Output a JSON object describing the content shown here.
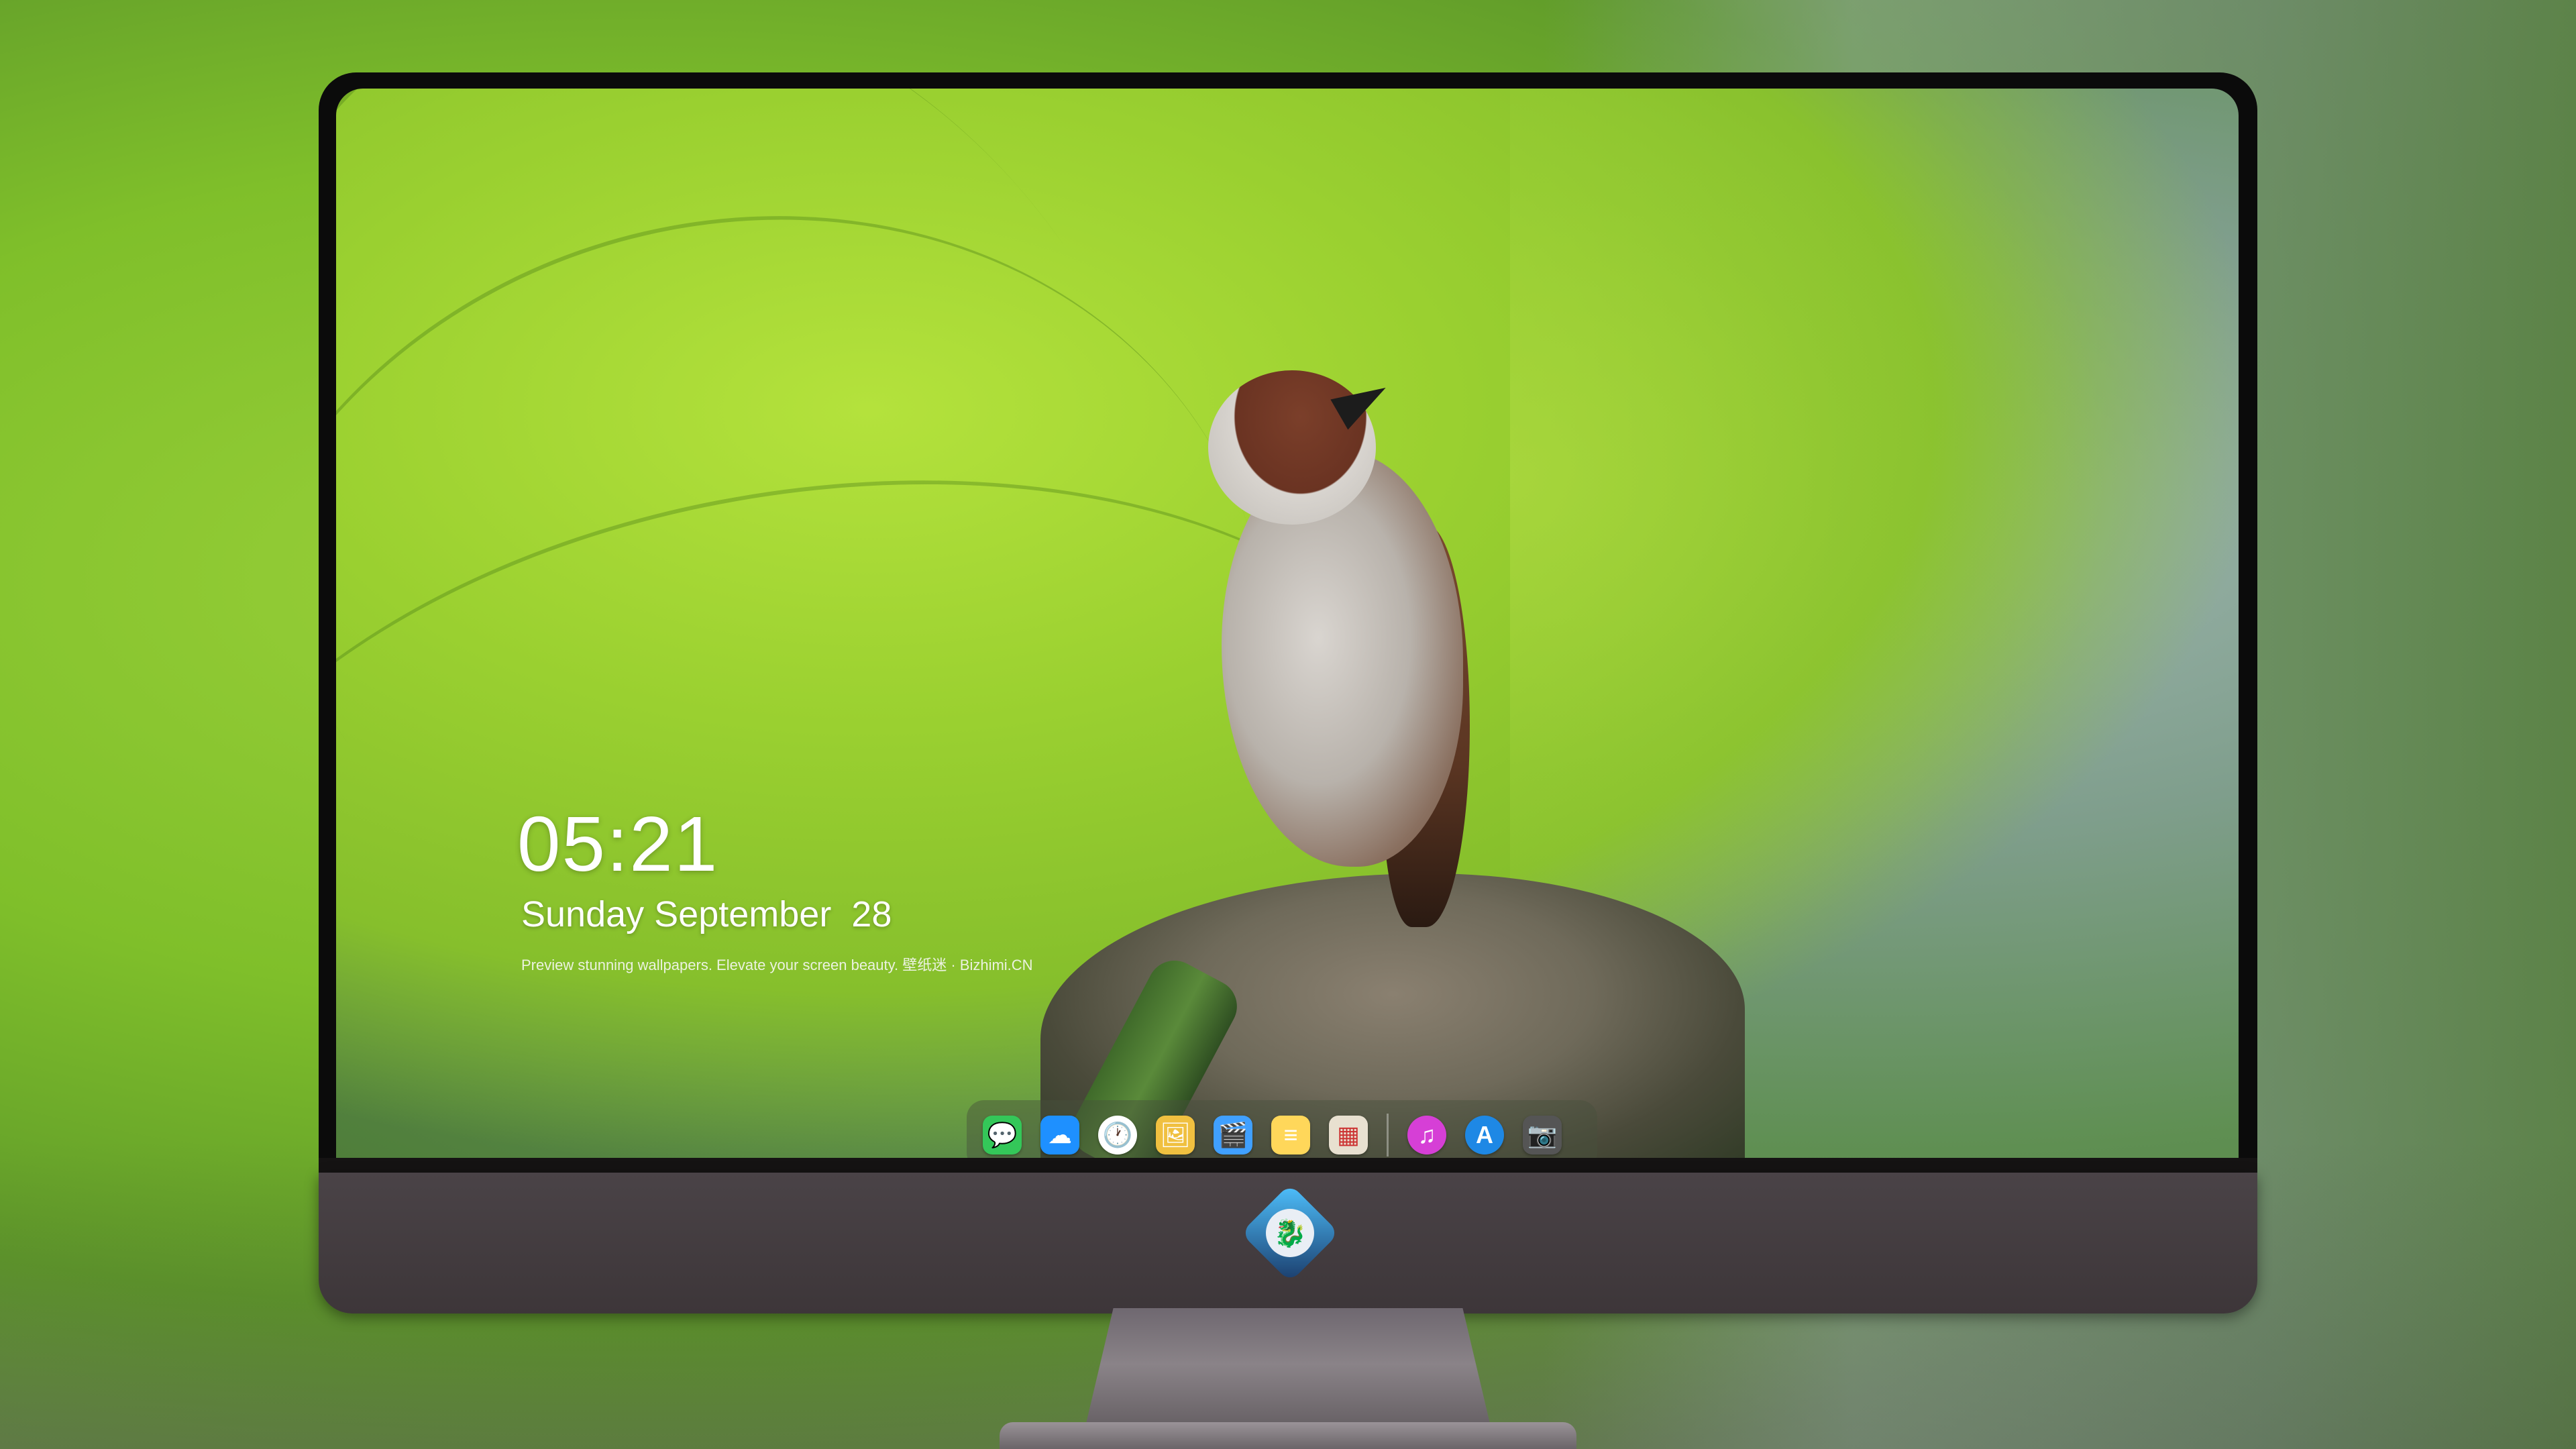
{
  "lock_screen": {
    "time": "05:21",
    "date": "Sunday September  28",
    "caption": "Preview stunning wallpapers. Elevate your screen beauty. 壁纸迷 · Bizhimi.CN"
  },
  "dock": {
    "items": [
      {
        "name": "messages-icon",
        "glyph": "💬",
        "color": "#34c759"
      },
      {
        "name": "weather-icon",
        "glyph": "☁",
        "color": "#1e90ff"
      },
      {
        "name": "clock-icon",
        "glyph": "🕐",
        "color": "#ffffff"
      },
      {
        "name": "preview-icon",
        "glyph": "🖼",
        "color": "#f0c040"
      },
      {
        "name": "clips-icon",
        "glyph": "🎬",
        "color": "#40a0ff"
      },
      {
        "name": "notes-icon",
        "glyph": "≡",
        "color": "#ffd75a"
      },
      {
        "name": "photo-booth-icon",
        "glyph": "▦",
        "color": "#e8e0d0"
      },
      {
        "name": "music-icon",
        "glyph": "♫",
        "color": "#d63fd6"
      },
      {
        "name": "app-store-icon",
        "glyph": "A",
        "color": "#1e88e5"
      },
      {
        "name": "camera-icon",
        "glyph": "📷",
        "color": "#555555"
      }
    ]
  },
  "brand": {
    "logo_icon": "dragon-mascot-icon"
  }
}
